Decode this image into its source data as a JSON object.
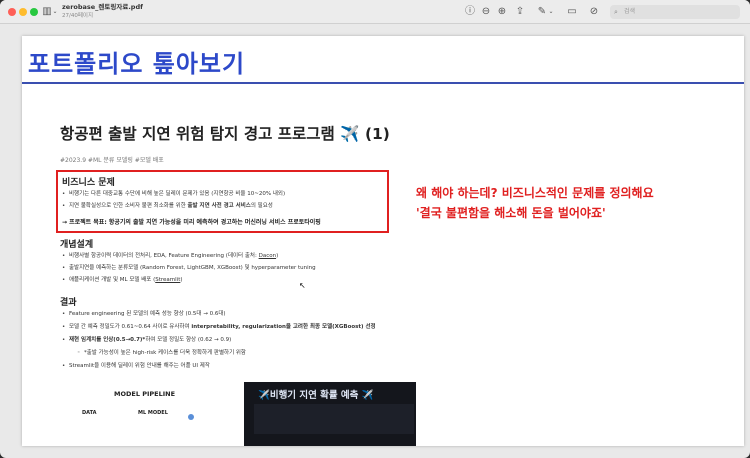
{
  "toolbar": {
    "file_name": "zerobase_렌토링자료.pdf",
    "page_count": "27/40페이지",
    "search_placeholder": "검색",
    "icons": [
      "sidebar-toggle-icon",
      "chevron-down-icon",
      "info-icon",
      "zoom-out-icon",
      "zoom-in-icon",
      "share-icon",
      "markup-pen-icon",
      "chevron-down-icon",
      "window-icon",
      "markup-icon",
      "search-icon"
    ]
  },
  "page": {
    "header_title": "포트폴리오 톺아보기",
    "slide_title": "항공편 출발 지연 위험 탐지 경고 프로그램",
    "slide_title_icon": "✈️",
    "slide_title_suffix": "(1)",
    "tags": "#2023.9 #ML 분류 모델링 #모델 배포",
    "business": {
      "heading": "비즈니스 문제",
      "bullets": [
        "비행기는 다른 대중교통 수단에 비해 높은 딜레이 문제가 있음 (지연항공 비율 10~20% 내외)",
        "지연 불확실성으로 인한 소비자 불편 최소화를 위한 ",
        "출발 지연 사전 경고 서비스",
        "의 필요성"
      ],
      "goal": "→ 프로젝트 목표: 항공기의 출발 지연 가능성을 미리 예측하여 경고하는 머신러닝 서비스 프로토타이핑"
    },
    "design": {
      "heading": "개념설계",
      "bullets": [
        "비행사별 항공이력 데이터의 전처리, EDA, Feature Engineering (데이터 출처: ",
        "Dacon",
        ")",
        "출발지연을 예측하는 분류모델 (Random Forest, LightGBM, XGBoost) 및 hyperparameter tuning",
        "애플리케이션 개발 및 ML 모델 배포 (",
        "Streamlit",
        ")"
      ]
    },
    "results": {
      "heading": "결과",
      "bullets": [
        "Feature engineering 된 모델의 예측 성능 향상 (0.5대 → 0.6대)",
        "모델 간 예측 정밀도가 0.61~0.64 사이로 유사하여 ",
        "interpretability, regularization을 고려한 최종 모델(XGBoost) 선정",
        "정밀도 0.64 도달하여 ",
        "재현 임계치를 인상(0.5→0.7)*",
        "하여 모델 정밀도 향상 (0.62 → 0.9)",
        "*출발 가능성이 높은 high-risk 케이스를 더욱 정확하게 판별하기 위함",
        "Streamlit을 이용해 딜레이 위험 안내를 해주는 어플 UI 제작"
      ]
    },
    "annotation": {
      "line1": "왜 해야 하는데? 비즈니스적인 문제를 정의해요",
      "line2": "'결국 불편함을 해소해 돈을 벌어야죠'"
    },
    "pipeline": {
      "title": "MODEL PIPELINE",
      "col1": "DATA",
      "col2": "ML MODEL"
    },
    "app_preview_title": "✈️비행기 지연 확률 예측 ✈️"
  },
  "colors": {
    "header_blue": "#2d49c9",
    "annotation_red": "#e02020",
    "dark_panel": "#14161c"
  }
}
